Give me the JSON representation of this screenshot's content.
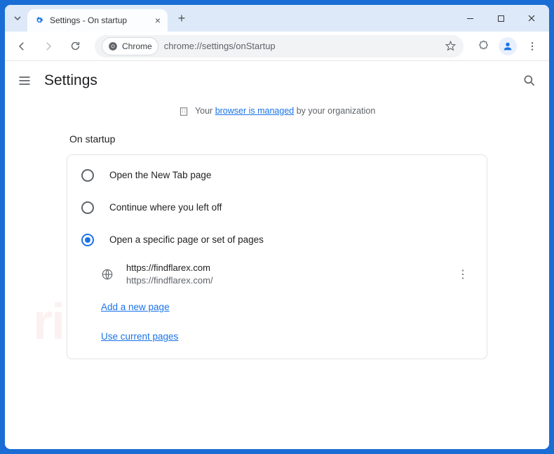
{
  "window": {
    "tab_title": "Settings - On startup"
  },
  "toolbar": {
    "chip_label": "Chrome",
    "url": "chrome://settings/onStartup"
  },
  "header": {
    "title": "Settings"
  },
  "managed": {
    "prefix": "Your ",
    "link": "browser is managed",
    "suffix": " by your organization"
  },
  "section": {
    "title": "On startup",
    "options": [
      {
        "label": "Open the New Tab page",
        "selected": false
      },
      {
        "label": "Continue where you left off",
        "selected": false
      },
      {
        "label": "Open a specific page or set of pages",
        "selected": true
      }
    ],
    "page": {
      "title": "https://findflarex.com",
      "url": "https://findflarex.com/"
    },
    "add_link": "Add a new page",
    "use_link": "Use current pages"
  }
}
